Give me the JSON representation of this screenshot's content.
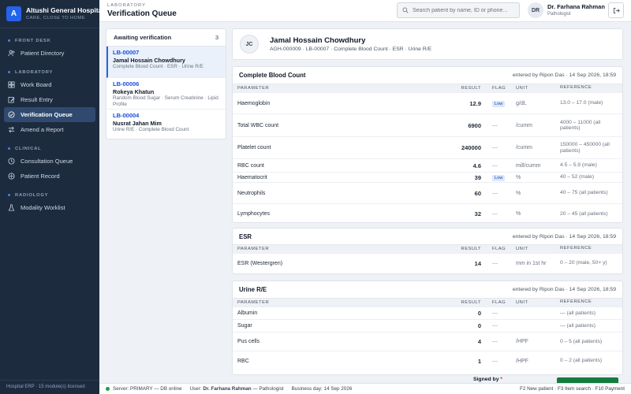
{
  "brand": {
    "logo_letter": "A",
    "name": "Altushi General Hospital",
    "tagline": "CARE, CLOSE TO HOME"
  },
  "sidebar": {
    "sections": [
      {
        "label": "FRONT DESK",
        "items": [
          {
            "label": "Patient Directory",
            "icon": "users-icon"
          }
        ]
      },
      {
        "label": "LABORATORY",
        "items": [
          {
            "label": "Work Board",
            "icon": "board-icon"
          },
          {
            "label": "Result Entry",
            "icon": "edit-icon"
          },
          {
            "label": "Verification Queue",
            "icon": "check-circle-icon",
            "active": true
          },
          {
            "label": "Amend a Report",
            "icon": "swap-icon"
          }
        ]
      },
      {
        "label": "CLINICAL",
        "items": [
          {
            "label": "Consultation Queue",
            "icon": "history-icon"
          },
          {
            "label": "Patient Record",
            "icon": "record-icon"
          }
        ]
      },
      {
        "label": "RADIOLOGY",
        "items": [
          {
            "label": "Modality Worklist",
            "icon": "flask-icon"
          }
        ]
      }
    ],
    "footer": "Hospital ERP · 15 module(s) licensed"
  },
  "topbar": {
    "breadcrumb": "LABORATORY",
    "title": "Verification Queue",
    "search_placeholder": "Search patient by name, ID or phone...",
    "user_initials": "DR",
    "user_name": "Dr. Farhana Rahman",
    "user_role": "Pathologist"
  },
  "queue": {
    "title": "Awaiting verification",
    "count": "3",
    "items": [
      {
        "id": "LB-00007",
        "name": "Jamal Hossain Chowdhury",
        "tests": "Complete Blood Count · ESR · Urine R/E",
        "active": true
      },
      {
        "id": "LB-00006",
        "name": "Rokeya Khatun",
        "tests": "Random Blood Sugar · Serum Creatinine · Lipid Profile"
      },
      {
        "id": "LB-00004",
        "name": "Nusrat Jahan Mim",
        "tests": "Urine R/E · Complete Blood Count"
      }
    ]
  },
  "patient": {
    "initials": "JC",
    "name": "Jamal Hossain Chowdhury",
    "meta": "AGH-000009 · LB-00007 · Complete Blood Count · ESR · Urine R/E"
  },
  "columns": {
    "param": "PARAMETER",
    "result": "RESULT",
    "flag": "FLAG",
    "unit": "UNIT",
    "ref": "REFERENCE"
  },
  "panels": [
    {
      "title": "Complete Blood Count",
      "entered": "entered by Ripon Das · 14 Sep 2026, 18:59",
      "rows": [
        {
          "param": "Haemoglobin",
          "result": "12.9",
          "flag": "Low",
          "unit": "g/dL",
          "ref": "13.0 – 17.0 (male)"
        },
        {
          "param": "Total WBC count",
          "result": "6900",
          "flag": "—",
          "unit": "/cumm",
          "ref": "4000 – 11000 (all patients)"
        },
        {
          "param": "Platelet count",
          "result": "240000",
          "flag": "—",
          "unit": "/cumm",
          "ref": "150000 – 450000 (all patients)"
        },
        {
          "param": "RBC count",
          "result": "4.6",
          "flag": "—",
          "unit": "mill/cumm",
          "ref": "4.5 – 5.9 (male)"
        },
        {
          "param": "Haematocrit",
          "result": "39",
          "flag": "Low",
          "unit": "%",
          "ref": "40 – 52 (male)"
        },
        {
          "param": "Neutrophils",
          "result": "60",
          "flag": "—",
          "unit": "%",
          "ref": "40 – 75 (all patients)"
        },
        {
          "param": "Lymphocytes",
          "result": "32",
          "flag": "—",
          "unit": "%",
          "ref": "20 – 45 (all patients)"
        }
      ]
    },
    {
      "title": "ESR",
      "entered": "entered by Ripon Das · 14 Sep 2026, 18:59",
      "rows": [
        {
          "param": "ESR (Westergren)",
          "result": "14",
          "flag": "—",
          "unit": "mm in 1st hr",
          "ref": "0 – 20 (male, 50+ y)"
        }
      ]
    },
    {
      "title": "Urine R/E",
      "entered": "entered by Ripon Das · 14 Sep 2026, 18:59",
      "rows": [
        {
          "param": "Albumin",
          "result": "0",
          "flag": "—",
          "unit": "",
          "ref": "— (all patients)"
        },
        {
          "param": "Sugar",
          "result": "0",
          "flag": "—",
          "unit": "",
          "ref": "— (all patients)"
        },
        {
          "param": "Pus cells",
          "result": "4",
          "flag": "—",
          "unit": "/HPF",
          "ref": "0 – 5 (all patients)"
        },
        {
          "param": "RBC",
          "result": "1",
          "flag": "—",
          "unit": "/HPF",
          "ref": "0 – 2 (all patients)"
        }
      ]
    }
  ],
  "signed_by_label": "Signed by",
  "signed_required": "*",
  "statusbar": {
    "server": "Server: PRIMARY — DB online",
    "user_prefix": "User:",
    "user_name": "Dr. Farhana Rahman",
    "user_suffix": "— Pathologist",
    "business_day": "Business day: 14 Sep 2026",
    "shortcuts": "F2 New patient · F3 Item search · F10 Payment"
  },
  "colors": {
    "sidebar_bg": "#1d2b3f",
    "accent": "#2563eb",
    "low_flag": "#1e40af",
    "online": "#16a34a",
    "sign_button": "#157a3e"
  }
}
